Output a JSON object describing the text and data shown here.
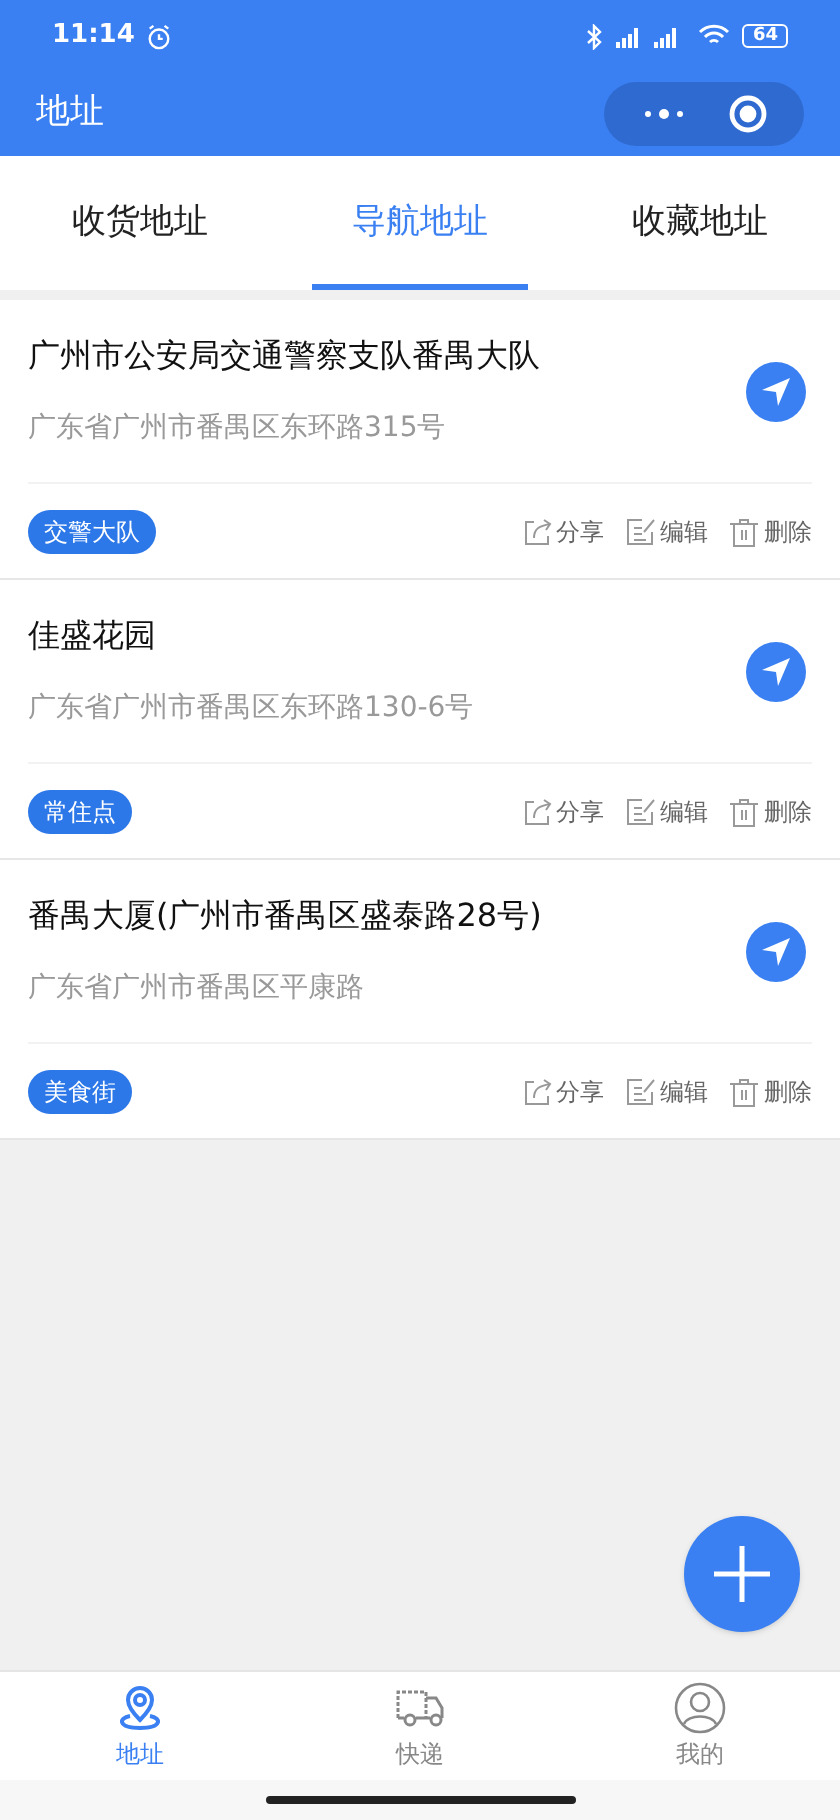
{
  "status_bar": {
    "time": "11:14",
    "battery": "64"
  },
  "header": {
    "title": "地址"
  },
  "tabs": [
    {
      "label": "收货地址",
      "selected": false
    },
    {
      "label": "导航地址",
      "selected": true
    },
    {
      "label": "收藏地址",
      "selected": false
    }
  ],
  "addresses": [
    {
      "name": "广州市公安局交通警察支队番禺大队",
      "address": "广东省广州市番禺区东环路315号",
      "tag": "交警大队",
      "share": "分享",
      "edit": "编辑",
      "delete": "删除"
    },
    {
      "name": "佳盛花园",
      "address": "广东省广州市番禺区东环路130-6号",
      "tag": "常住点",
      "share": "分享",
      "edit": "编辑",
      "delete": "删除"
    },
    {
      "name": "番禺大厦(广州市番禺区盛泰路28号)",
      "address": "广东省广州市番禺区平康路",
      "tag": "美食街",
      "share": "分享",
      "edit": "编辑",
      "delete": "删除"
    }
  ],
  "bottom_nav": [
    {
      "label": "地址",
      "kind": "pin",
      "selected": true
    },
    {
      "label": "快递",
      "kind": "truck",
      "selected": false
    },
    {
      "label": "我的",
      "kind": "user",
      "selected": false
    }
  ]
}
